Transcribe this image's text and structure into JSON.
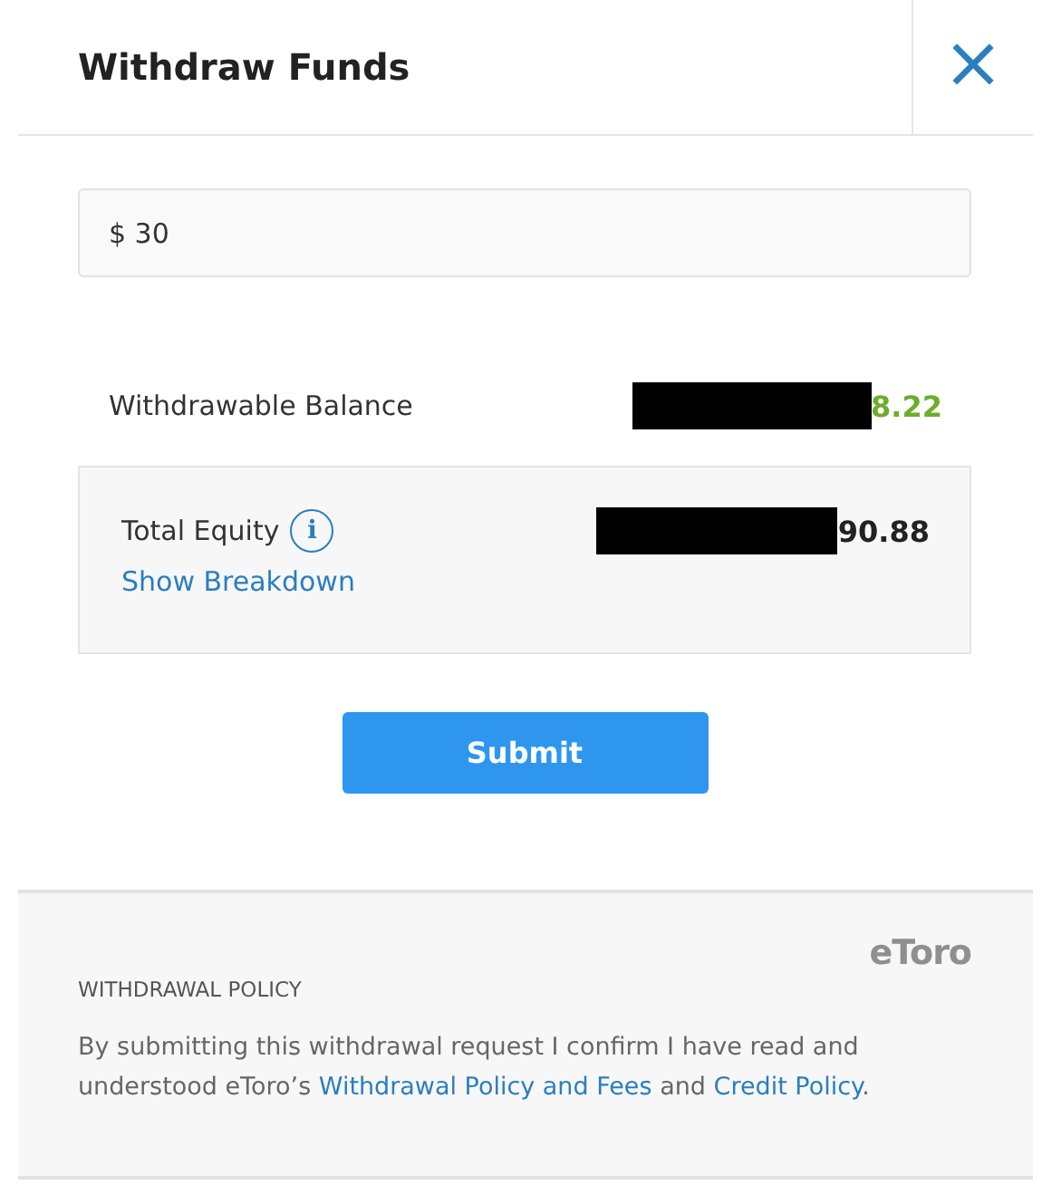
{
  "dialog": {
    "title": "Withdraw Funds",
    "close_label": "×"
  },
  "amount_field": {
    "value": "$ 30"
  },
  "withdrawable_balance": {
    "label": "Withdrawable Balance",
    "value": "8.22",
    "redacted": true
  },
  "total_equity": {
    "label": "Total Equity",
    "info_label": "i",
    "value": "90.88",
    "redacted": true,
    "link": "Show Breakdown"
  },
  "submit_button": "Submit",
  "policy": {
    "logo": "eToro",
    "heading": "WITHDRAWAL POLICY",
    "segments": [
      {
        "kind": "text",
        "text": "By submitting this withdrawal request I confirm I have read and understood eToro’s "
      },
      {
        "kind": "link",
        "text": "Withdrawal Policy and Fees"
      },
      {
        "kind": "text",
        "text": " and "
      },
      {
        "kind": "link",
        "text": "Credit Policy"
      },
      {
        "kind": "text",
        "text": "."
      }
    ]
  }
}
